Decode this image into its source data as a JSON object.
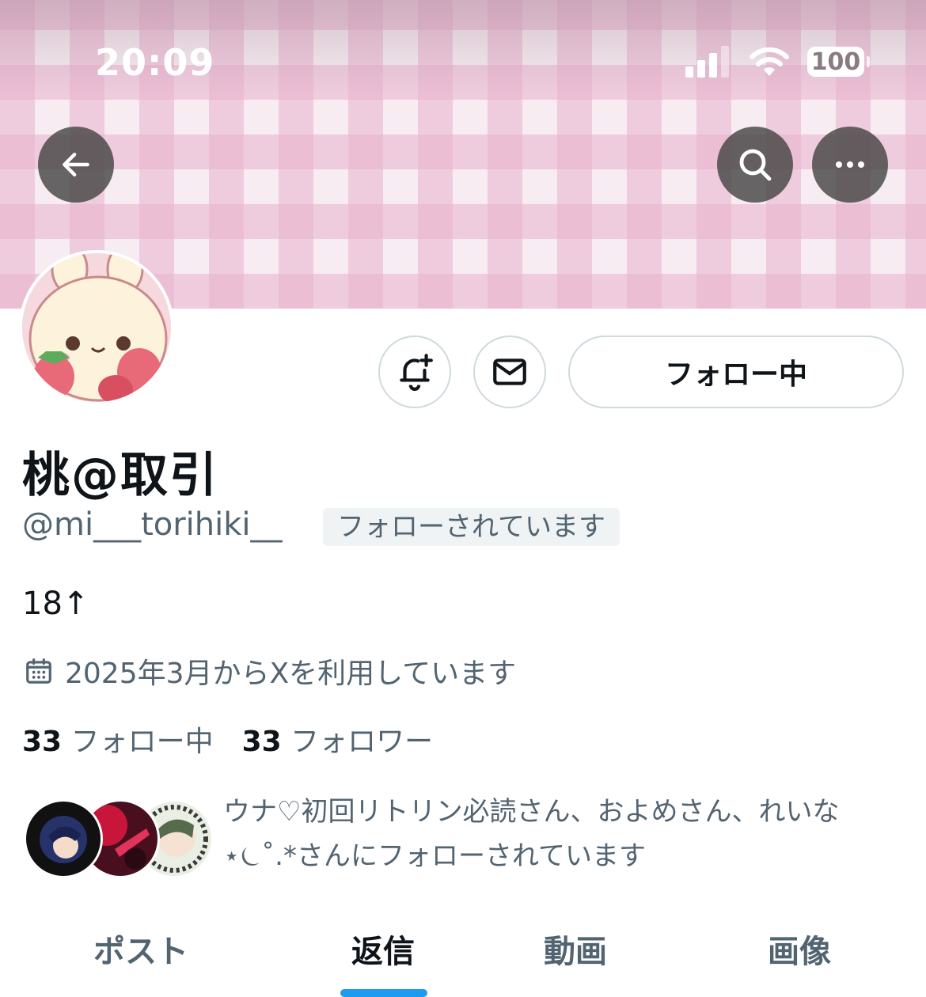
{
  "status_bar": {
    "time": "20:09",
    "battery": "100"
  },
  "header": {
    "back_icon": "arrow-left-icon",
    "search_icon": "search-icon",
    "more_icon": "more-horizontal-icon"
  },
  "profile": {
    "display_name": "桃@取引",
    "handle": "@mi___torihiki__",
    "follows_you_badge": "フォローされています",
    "bio": "18↑",
    "joined": "2025年3月からXを利用しています",
    "following_count": "33",
    "following_label": "フォロー中",
    "followers_count": "33",
    "followers_label": "フォロワー",
    "follow_button_label": "フォロー中"
  },
  "mutuals": {
    "line1": "ウナ♡初回リトリン必読さん、およめさん、れいな",
    "line2": "⋆⏾˚.*さんにフォローされています"
  },
  "tabs": [
    {
      "label": "ポスト"
    },
    {
      "label": "返信"
    },
    {
      "label": "動画"
    },
    {
      "label": "画像"
    }
  ],
  "active_tab": "返信",
  "colors": {
    "accent": "#1d9bf0",
    "text_primary": "#0f1419",
    "text_secondary": "#536471",
    "border": "#cfd9de"
  }
}
